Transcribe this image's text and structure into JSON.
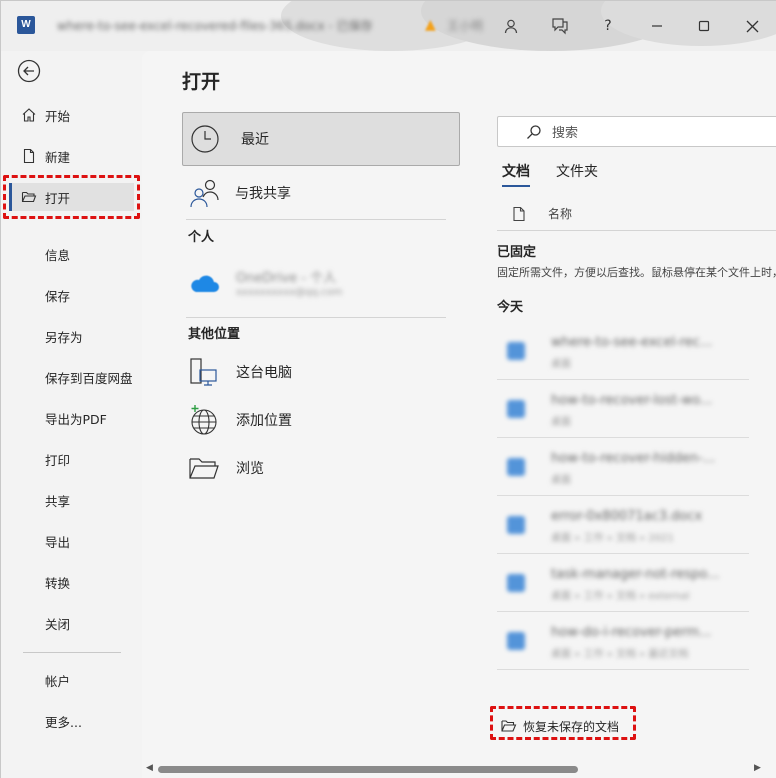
{
  "titlebar": {
    "app_logo": "W",
    "document_title": "where-to-see-excel-recovered-files-365.docx - 已保存",
    "warning_text": "王小明",
    "buttons": {
      "account": "person-icon",
      "feedback": "feedback-icon",
      "help": "?",
      "minimize": "minimize-icon",
      "maximize": "maximize-icon",
      "close": "close-icon"
    }
  },
  "nav": {
    "back_icon": "back-arrow-icon",
    "top_items": [
      {
        "label": "开始",
        "icon": "home-icon"
      },
      {
        "label": "新建",
        "icon": "new-doc-icon"
      },
      {
        "label": "打开",
        "icon": "folder-open-icon",
        "active": true
      }
    ],
    "sub_items": [
      "信息",
      "保存",
      "另存为",
      "保存到百度网盘",
      "导出为PDF",
      "打印",
      "共享",
      "导出",
      "转换",
      "关闭"
    ],
    "bottom_items": [
      "帐户",
      "更多..."
    ]
  },
  "main": {
    "title": "打开",
    "locations": {
      "recent": "最近",
      "shared": "与我共享",
      "personal_header": "个人",
      "onedrive_name": "OneDrive - 个人",
      "onedrive_email": "xxxxxxxxxx@qq.com",
      "other_header": "其他位置",
      "this_pc": "这台电脑",
      "add_place": "添加位置",
      "browse": "浏览"
    },
    "search_placeholder": "搜索",
    "tabs": [
      "文档",
      "文件夹"
    ],
    "column_name": "名称",
    "pinned_header": "已固定",
    "pinned_desc": "固定所需文件，方便以后查找。鼠标悬停在某个文件上时，单击",
    "today_header": "今天",
    "files": [
      {
        "name": "where-to-see-excel-rec...",
        "path": "桌面"
      },
      {
        "name": "how-to-recover-lost-wo...",
        "path": "桌面"
      },
      {
        "name": "how-to-recover-hidden-...",
        "path": "桌面"
      },
      {
        "name": "error-0x80071ac3.docx",
        "path": "桌面 » 工作 » 文档 » 2021"
      },
      {
        "name": "task-manager-not-respo...",
        "path": "桌面 » 工作 » 文档 » external"
      },
      {
        "name": "how-do-i-recover-perm...",
        "path": "桌面 » 工作 » 文档 » 最近文档"
      }
    ],
    "recover_label": "恢复未保存的文档"
  }
}
